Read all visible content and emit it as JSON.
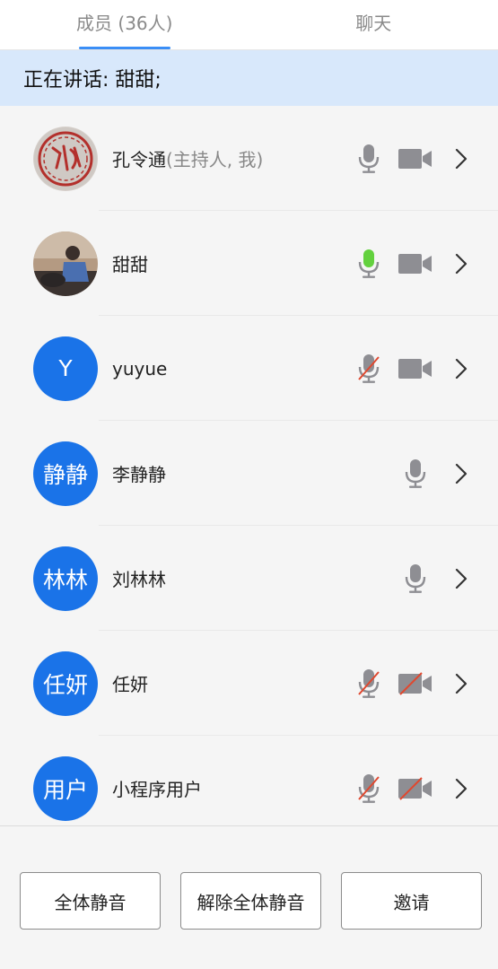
{
  "tabs": {
    "members": "成员 (36人)",
    "chat": "聊天"
  },
  "speaking_banner": "正在讲话: 甜甜;",
  "participants": [
    {
      "name": "孔令通",
      "role": "(主持人, 我)",
      "avatar": "seal-avatar",
      "mic": "on",
      "camera": "off"
    },
    {
      "name": "甜甜",
      "role": "",
      "avatar": "photo-avatar",
      "mic": "speaking",
      "camera": "off"
    },
    {
      "name": "yuyue",
      "role": "",
      "avatar_text": "Y",
      "mic": "muted",
      "camera": "off"
    },
    {
      "name": "李静静",
      "role": "",
      "avatar_text": "静静",
      "mic": "on",
      "camera": "none"
    },
    {
      "name": "刘林林",
      "role": "",
      "avatar_text": "林林",
      "mic": "on",
      "camera": "none"
    },
    {
      "name": "任妍",
      "role": "",
      "avatar_text": "任妍",
      "mic": "muted",
      "camera": "disabled"
    },
    {
      "name": "小程序用户",
      "role": "",
      "avatar_text": "用户",
      "mic": "muted",
      "camera": "disabled"
    }
  ],
  "footer": {
    "mute_all": "全体静音",
    "unmute_all": "解除全体静音",
    "invite": "邀请"
  },
  "colors": {
    "accent": "#3a8ef6",
    "avatar_blue": "#1a73e8",
    "speaking_green": "#63d13e",
    "icon_gray": "#8e8e93",
    "muted_red": "#e0482f"
  }
}
